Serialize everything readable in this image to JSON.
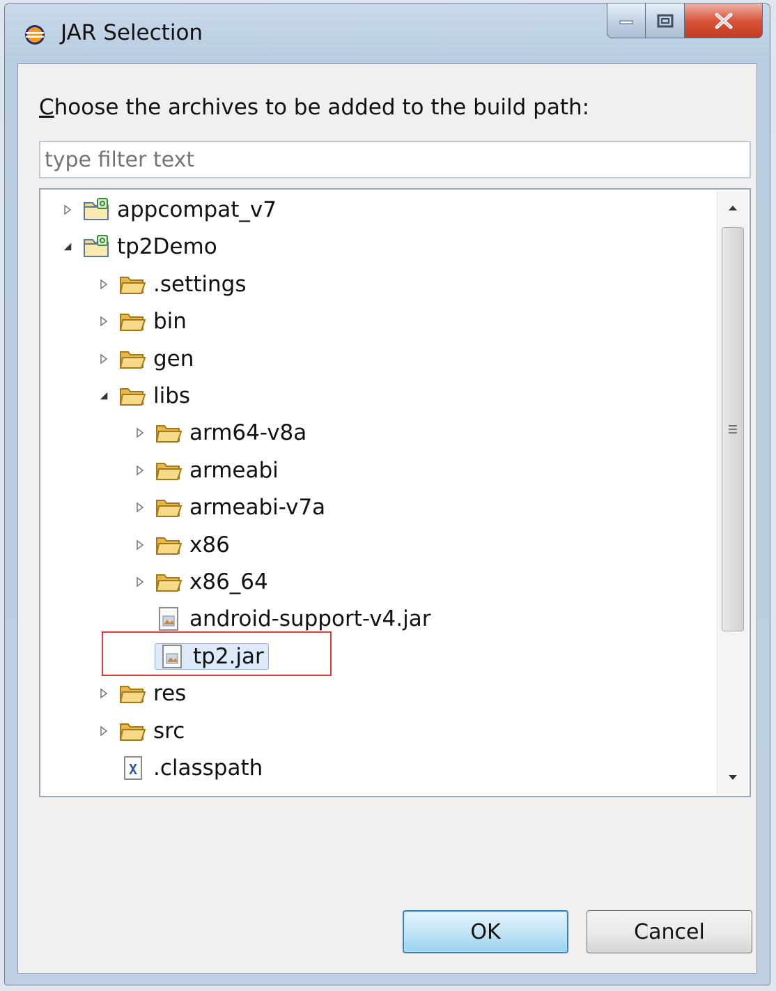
{
  "window": {
    "title": "JAR Selection"
  },
  "prompt": {
    "prefix": "C",
    "rest": "hoose the archives to be added to the build path:"
  },
  "filter": {
    "placeholder": "type filter text",
    "value": ""
  },
  "tree": {
    "items": [
      {
        "label": "appcompat_v7",
        "kind": "project",
        "expander": "collapsed"
      },
      {
        "label": "tp2Demo",
        "kind": "project",
        "expander": "expanded"
      },
      {
        "label": ".settings",
        "kind": "folder",
        "expander": "collapsed"
      },
      {
        "label": "bin",
        "kind": "folder",
        "expander": "collapsed"
      },
      {
        "label": "gen",
        "kind": "folder",
        "expander": "collapsed"
      },
      {
        "label": "libs",
        "kind": "folder",
        "expander": "expanded"
      },
      {
        "label": "arm64-v8a",
        "kind": "folder",
        "expander": "collapsed"
      },
      {
        "label": "armeabi",
        "kind": "folder",
        "expander": "collapsed"
      },
      {
        "label": "armeabi-v7a",
        "kind": "folder",
        "expander": "collapsed"
      },
      {
        "label": "x86",
        "kind": "folder",
        "expander": "collapsed"
      },
      {
        "label": "x86_64",
        "kind": "folder",
        "expander": "collapsed"
      },
      {
        "label": "android-support-v4.jar",
        "kind": "jar",
        "expander": "none"
      },
      {
        "label": "tp2.jar",
        "kind": "jar",
        "expander": "none",
        "selected": true
      },
      {
        "label": "res",
        "kind": "folder",
        "expander": "collapsed"
      },
      {
        "label": "src",
        "kind": "folder",
        "expander": "collapsed"
      },
      {
        "label": ".classpath",
        "kind": "xml",
        "expander": "none"
      }
    ]
  },
  "buttons": {
    "ok": "OK",
    "cancel": "Cancel"
  },
  "colors": {
    "highlight": "#e03a3a",
    "folder": "#f0c050",
    "selection": "#dceaf9"
  }
}
